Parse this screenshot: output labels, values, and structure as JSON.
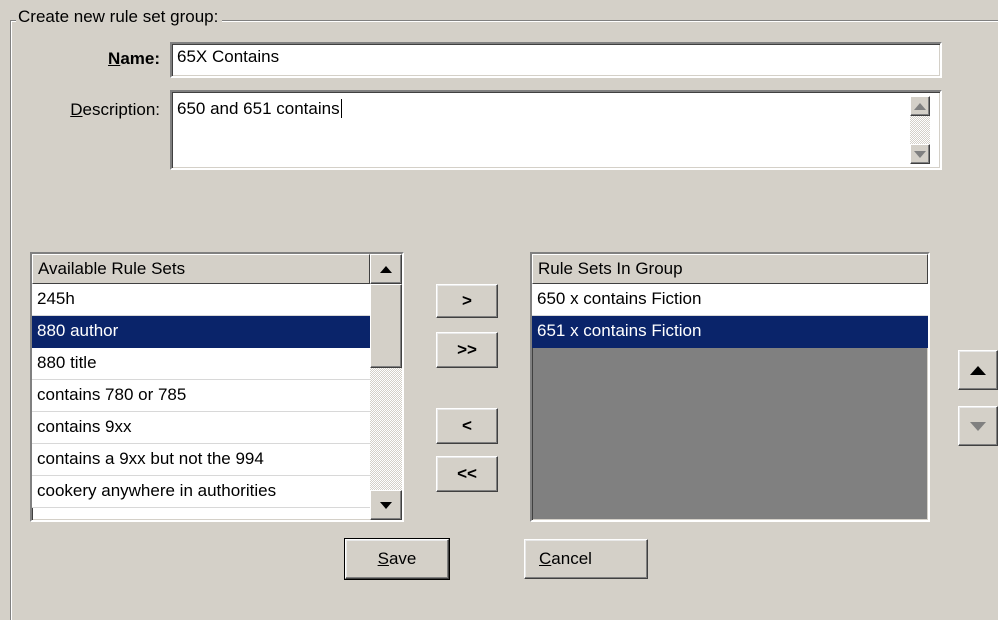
{
  "group": {
    "title": "Create new rule set group:"
  },
  "name": {
    "label_accel": "N",
    "label_rest": "ame:",
    "value": "65X Contains"
  },
  "description": {
    "label_accel": "D",
    "label_rest": "escription:",
    "value": "650 and 651 contains"
  },
  "available": {
    "header": "Available Rule Sets",
    "items": [
      {
        "label": "245h",
        "selected": false
      },
      {
        "label": "880 author",
        "selected": true
      },
      {
        "label": "880 title",
        "selected": false
      },
      {
        "label": "contains 780 or 785",
        "selected": false
      },
      {
        "label": "contains 9xx",
        "selected": false
      },
      {
        "label": "contains a 9xx but not the 994",
        "selected": false
      },
      {
        "label": "cookery anywhere in authorities",
        "selected": false
      }
    ]
  },
  "in_group": {
    "header": "Rule Sets In Group",
    "items": [
      {
        "label": "650 x contains Fiction",
        "selected": false
      },
      {
        "label": "651 x contains Fiction",
        "selected": true
      }
    ]
  },
  "transfer": {
    "add": ">",
    "add_all": ">>",
    "remove": "<",
    "remove_all": "<<"
  },
  "actions": {
    "save_accel": "S",
    "save_rest": "ave",
    "cancel_accel": "C",
    "cancel_rest": "ancel"
  },
  "colors": {
    "selection": "#0a246a",
    "face": "#d4d0c8",
    "empty_list": "#808080"
  },
  "icons": {
    "move_up": "triangle-up-icon",
    "move_down": "triangle-down-icon"
  }
}
